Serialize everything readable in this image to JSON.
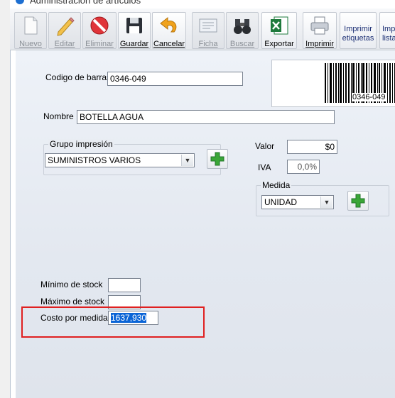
{
  "window": {
    "title": "Administración de artículos"
  },
  "toolbar": {
    "buttons": [
      {
        "label": "Nuevo",
        "icon": "new-document-icon",
        "enabled": false
      },
      {
        "label": "Editar",
        "icon": "pencil-icon",
        "enabled": false
      },
      {
        "label": "Eliminar",
        "icon": "no-entry-icon",
        "enabled": false
      },
      {
        "label": "Guardar",
        "icon": "floppy-disk-icon",
        "enabled": true
      },
      {
        "label": "Cancelar",
        "icon": "undo-arrow-icon",
        "enabled": true
      },
      {
        "label": "Ficha",
        "icon": "card-icon",
        "enabled": false
      },
      {
        "label": "Buscar",
        "icon": "binoculars-icon",
        "enabled": false
      },
      {
        "label": "Exportar",
        "icon": "excel-icon",
        "enabled": true
      },
      {
        "label": "Imprimir",
        "icon": "printer-icon",
        "enabled": true
      }
    ],
    "print_labels": {
      "line1": "Imprimir",
      "line2": "etiquetas"
    },
    "print_list": {
      "line1": "Impr",
      "line2": "lista"
    }
  },
  "form": {
    "barcode_label": "Codigo de barras",
    "barcode_value": "0346-049",
    "barcode_image_text": "0346-049",
    "name_label": "Nombre",
    "name_value": "BOTELLA AGUA",
    "print_group": {
      "legend": "Grupo impresión",
      "selected": "SUMINISTROS VARIOS"
    },
    "value_label": "Valor",
    "value_value": "$0",
    "iva_label": "IVA",
    "iva_value": "0,0%",
    "measure": {
      "legend": "Medida",
      "selected": "UNIDAD"
    },
    "min_stock_label": "Mínimo de stock",
    "min_stock_value": "",
    "max_stock_label": "Máximo de stock",
    "max_stock_value": "",
    "cost_label": "Costo por medida",
    "cost_value": "1637,930"
  },
  "colors": {
    "highlight": "#e02020",
    "selection": "#0a64d6",
    "plus": "#3aa637"
  }
}
